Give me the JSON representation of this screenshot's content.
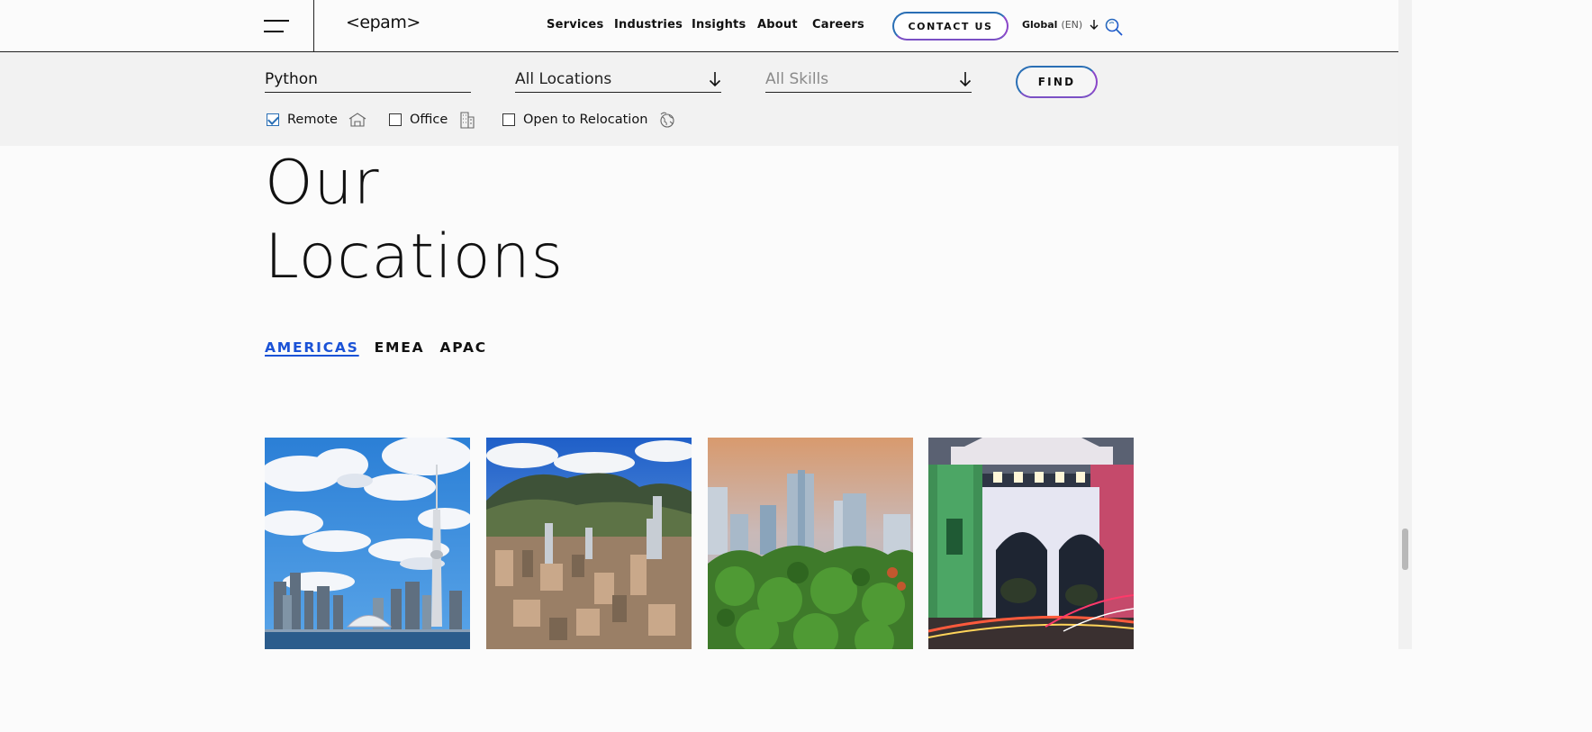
{
  "header": {
    "logo": "<epam>",
    "nav": [
      {
        "label": "Services"
      },
      {
        "label": "Industries"
      },
      {
        "label": "Insights"
      },
      {
        "label": "About"
      },
      {
        "label": "Careers"
      }
    ],
    "contact_label": "CONTACT US",
    "global_label": "Global",
    "global_lang": "(EN)"
  },
  "filter": {
    "keyword_value": "Python",
    "location_value": "All Locations",
    "skills_placeholder": "All Skills",
    "find_label": "FIND",
    "checkboxes": [
      {
        "label": "Remote",
        "checked": true,
        "icon": "house-icon"
      },
      {
        "label": "Office",
        "checked": false,
        "icon": "building-icon"
      },
      {
        "label": "Open to Relocation",
        "checked": false,
        "icon": "globe-icon"
      }
    ]
  },
  "main": {
    "title_line1": "Our",
    "title_line2": "Locations",
    "tabs": [
      {
        "label": "AMERICAS",
        "active": true
      },
      {
        "label": "EMEA",
        "active": false
      },
      {
        "label": "APAC",
        "active": false
      }
    ],
    "cards": [
      {
        "name": "city-card-toronto"
      },
      {
        "name": "city-card-bogota"
      },
      {
        "name": "city-card-green-city"
      },
      {
        "name": "city-card-arch"
      }
    ]
  },
  "colors": {
    "accent_blue": "#1a52d6",
    "button_border_start": "#2a6fb5",
    "button_border_end": "#8a46c8",
    "filter_band": "#f2f2f2"
  }
}
